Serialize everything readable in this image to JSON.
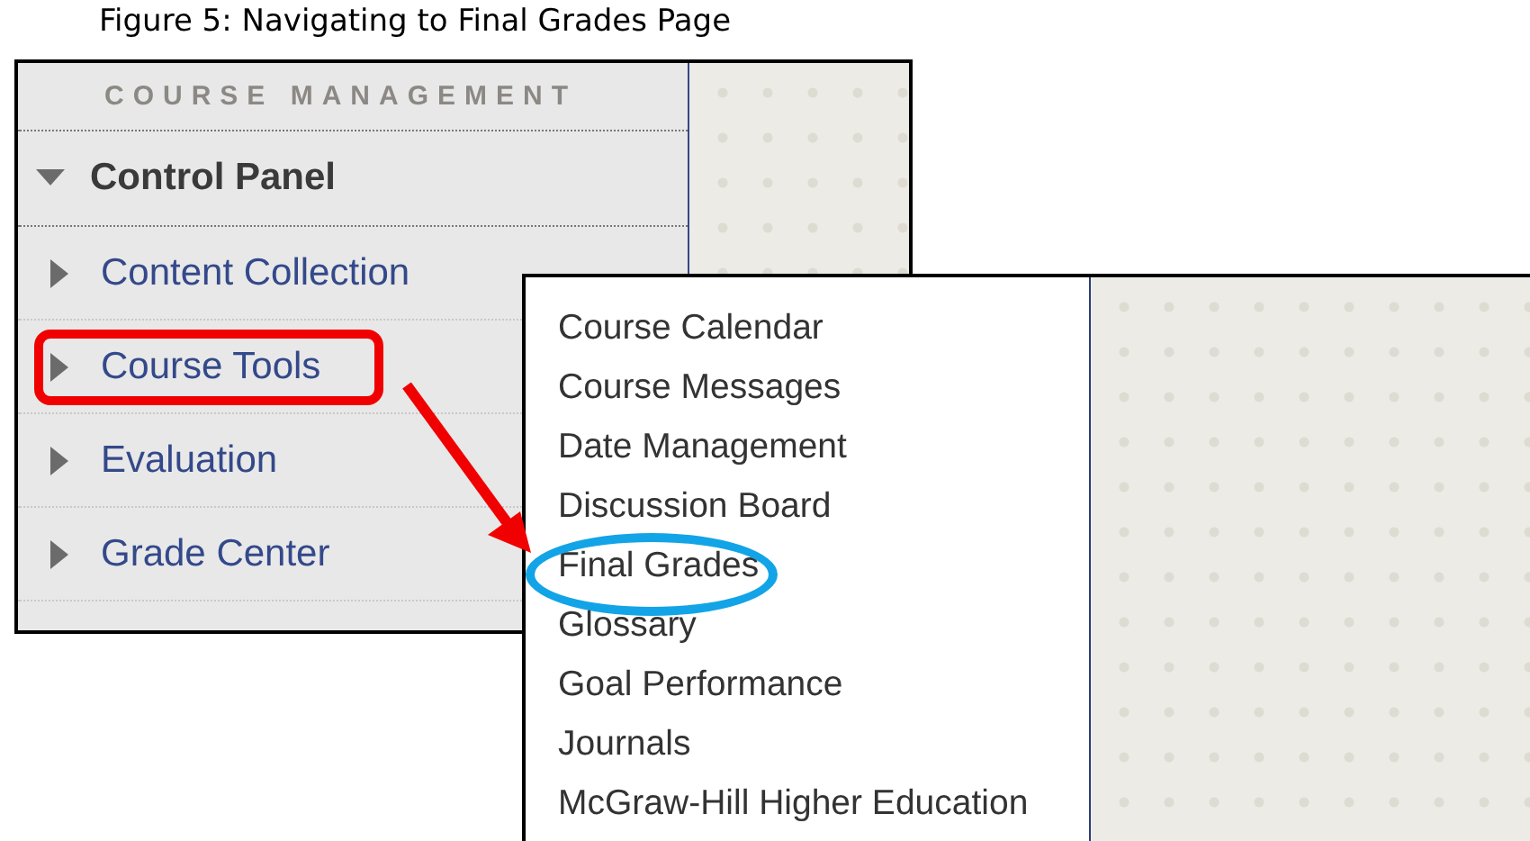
{
  "caption": "Figure 5: Navigating to Final Grades Page",
  "sidebar": {
    "heading": "COURSE MANAGEMENT",
    "section": {
      "label": "Control Panel",
      "expanded": true
    },
    "items": [
      {
        "label": "Content Collection",
        "expanded": false,
        "highlighted": false
      },
      {
        "label": "Course Tools",
        "expanded": false,
        "highlighted": true
      },
      {
        "label": "Evaluation",
        "expanded": false,
        "highlighted": false
      },
      {
        "label": "Grade Center",
        "expanded": false,
        "highlighted": false
      }
    ]
  },
  "menu": {
    "items": [
      {
        "label": "Course Calendar",
        "circled": false
      },
      {
        "label": "Course Messages",
        "circled": false
      },
      {
        "label": "Date Management",
        "circled": false
      },
      {
        "label": "Discussion Board",
        "circled": false
      },
      {
        "label": "Final Grades",
        "circled": true
      },
      {
        "label": "Glossary",
        "circled": false
      },
      {
        "label": "Goal Performance",
        "circled": false
      },
      {
        "label": "Journals",
        "circled": false
      },
      {
        "label": "McGraw-Hill Higher Education",
        "circled": false
      }
    ]
  }
}
